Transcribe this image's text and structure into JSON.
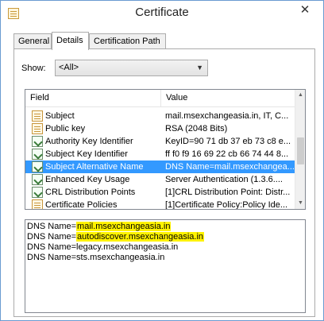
{
  "window": {
    "title": "Certificate",
    "close_glyph": "✕"
  },
  "tabs": [
    {
      "label": "General",
      "active": false
    },
    {
      "label": "Details",
      "active": true
    },
    {
      "label": "Certification Path",
      "active": false
    }
  ],
  "show": {
    "label": "Show:",
    "value": "<All>"
  },
  "list": {
    "columns": [
      "Field",
      "Value"
    ],
    "rows": [
      {
        "icon": "certificate-field-icon",
        "field": "Subject",
        "value": "mail.msexchangeasia.in, IT, C..."
      },
      {
        "icon": "certificate-field-icon",
        "field": "Public key",
        "value": "RSA (2048 Bits)"
      },
      {
        "icon": "extension-icon",
        "field": "Authority Key Identifier",
        "value": "KeyID=90 71 db 37 eb 73 c8 e..."
      },
      {
        "icon": "extension-icon",
        "field": "Subject Key Identifier",
        "value": "ff f0 f9 16 69 22 cb 66 74 44 8..."
      },
      {
        "icon": "extension-icon",
        "field": "Subject Alternative Name",
        "value": "DNS Name=mail.msexchangea...",
        "selected": true
      },
      {
        "icon": "extension-icon",
        "field": "Enhanced Key Usage",
        "value": "Server Authentication (1.3.6...."
      },
      {
        "icon": "extension-icon",
        "field": "CRL Distribution Points",
        "value": "[1]CRL Distribution Point: Distr..."
      },
      {
        "icon": "certificate-field-icon",
        "field": "Certificate Policies",
        "value": "[1]Certificate Policy:Policy Ide..."
      }
    ]
  },
  "detail": {
    "lines": [
      {
        "prefix": "DNS Name=",
        "value": "mail.msexchangeasia.in",
        "highlighted": true
      },
      {
        "prefix": "DNS Name=",
        "value": "autodiscover.msexchangeasia.in",
        "highlighted": true
      },
      {
        "prefix": "DNS Name=",
        "value": "legacy.msexchangeasia.in",
        "highlighted": false
      },
      {
        "prefix": "DNS Name=",
        "value": "sts.msexchangeasia.in",
        "highlighted": false
      }
    ]
  },
  "colors": {
    "selection": "#3399ff",
    "highlight": "#fff200",
    "window_border": "#6a9bd1"
  }
}
